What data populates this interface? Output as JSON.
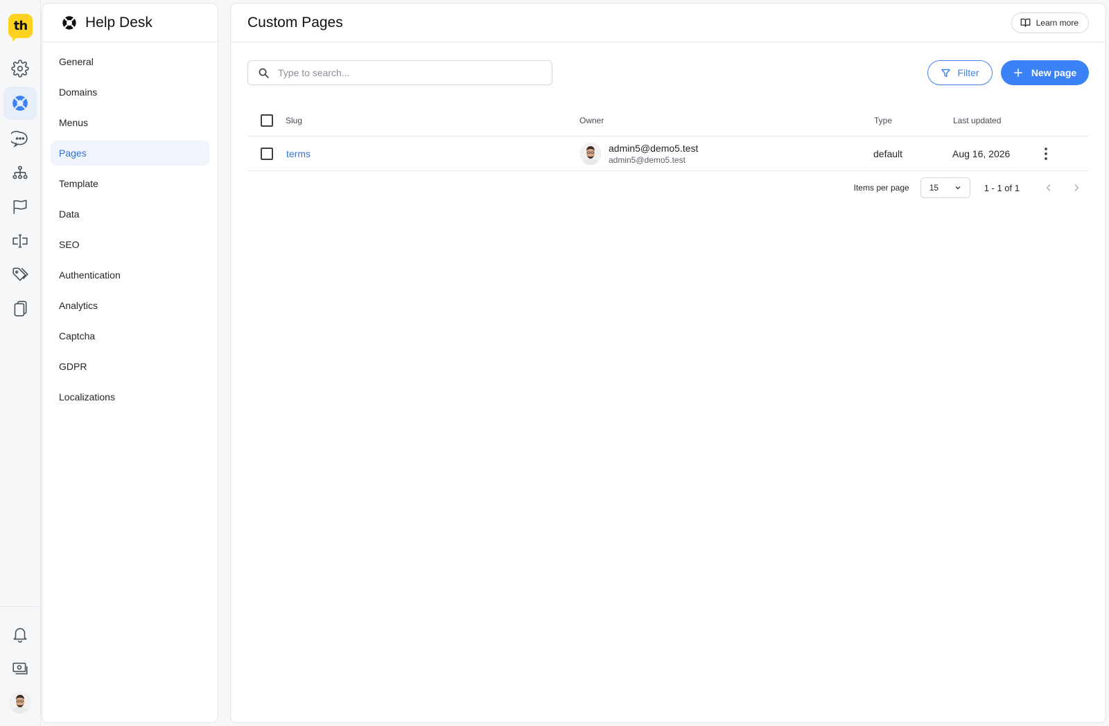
{
  "rail": {
    "logo_text": "th",
    "items": [
      {
        "icon": "gear-icon",
        "active": false
      },
      {
        "icon": "lifebuoy-icon",
        "active": true
      },
      {
        "icon": "chat-bubble-icon",
        "active": false
      },
      {
        "icon": "sitemap-icon",
        "active": false
      },
      {
        "icon": "flag-icon",
        "active": false
      },
      {
        "icon": "text-cursor-icon",
        "active": false
      },
      {
        "icon": "tags-icon",
        "active": false
      },
      {
        "icon": "copy-pages-icon",
        "active": false
      }
    ],
    "bottom": [
      {
        "icon": "bell-icon"
      },
      {
        "icon": "billing-icon"
      }
    ]
  },
  "subnav": {
    "title": "Help Desk",
    "items": [
      {
        "label": "General",
        "active": false
      },
      {
        "label": "Domains",
        "active": false
      },
      {
        "label": "Menus",
        "active": false
      },
      {
        "label": "Pages",
        "active": true
      },
      {
        "label": "Template",
        "active": false
      },
      {
        "label": "Data",
        "active": false
      },
      {
        "label": "SEO",
        "active": false
      },
      {
        "label": "Authentication",
        "active": false
      },
      {
        "label": "Analytics",
        "active": false
      },
      {
        "label": "Captcha",
        "active": false
      },
      {
        "label": "GDPR",
        "active": false
      },
      {
        "label": "Localizations",
        "active": false
      }
    ]
  },
  "header": {
    "title": "Custom Pages",
    "learn_more": "Learn more"
  },
  "toolbar": {
    "search_placeholder": "Type to search...",
    "search_value": "",
    "filter_label": "Filter",
    "new_label": "New page"
  },
  "table": {
    "columns": {
      "slug": "Slug",
      "owner": "Owner",
      "type": "Type",
      "updated": "Last updated"
    },
    "rows": [
      {
        "slug": "terms",
        "owner_name": "admin5@demo5.test",
        "owner_email": "admin5@demo5.test",
        "type": "default",
        "updated": "Aug 16, 2026"
      }
    ]
  },
  "pagination": {
    "items_per_page_label": "Items per page",
    "per_page": "15",
    "range": "1 - 1 of 1"
  },
  "colors": {
    "accent": "#3b82f6",
    "logo": "#ffd21f",
    "active_nav_bg": "#f0f5fd"
  }
}
